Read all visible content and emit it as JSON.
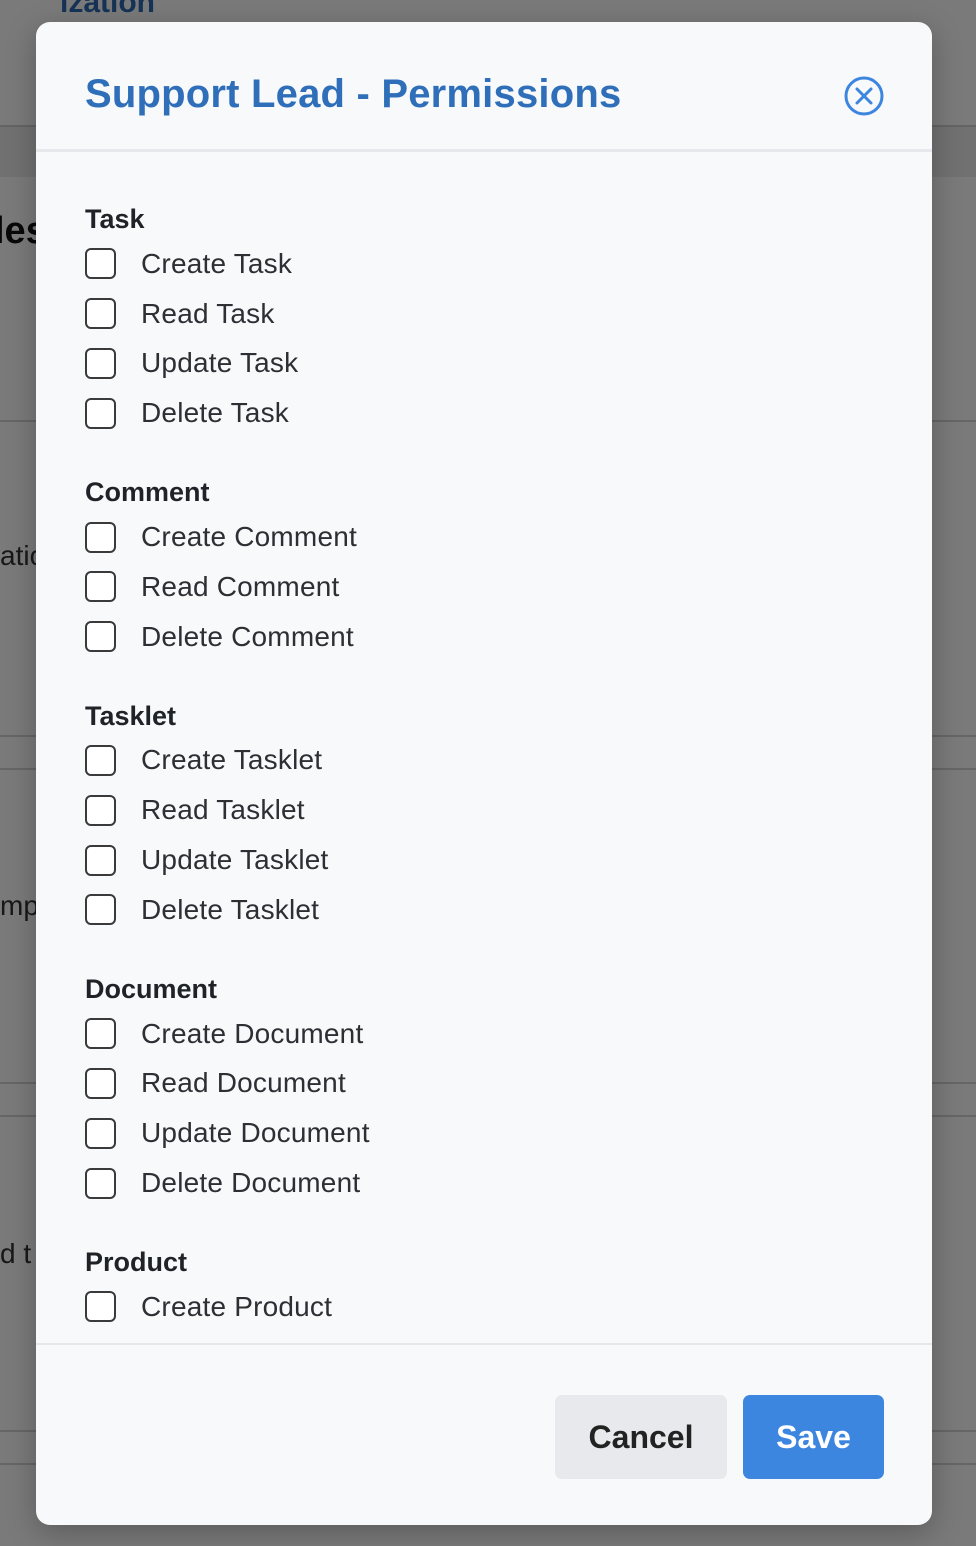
{
  "background": {
    "top_title": "ization",
    "heading": "les",
    "fragments": [
      "atio",
      "mpl",
      "d t"
    ]
  },
  "modal": {
    "title": "Support Lead - Permissions",
    "groups": [
      {
        "title": "Task",
        "permissions": [
          {
            "label": "Create Task",
            "checked": false
          },
          {
            "label": "Read Task",
            "checked": false
          },
          {
            "label": "Update Task",
            "checked": false
          },
          {
            "label": "Delete Task",
            "checked": false
          }
        ]
      },
      {
        "title": "Comment",
        "permissions": [
          {
            "label": "Create Comment",
            "checked": false
          },
          {
            "label": "Read Comment",
            "checked": false
          },
          {
            "label": "Delete Comment",
            "checked": false
          }
        ]
      },
      {
        "title": "Tasklet",
        "permissions": [
          {
            "label": "Create Tasklet",
            "checked": false
          },
          {
            "label": "Read Tasklet",
            "checked": false
          },
          {
            "label": "Update Tasklet",
            "checked": false
          },
          {
            "label": "Delete Tasklet",
            "checked": false
          }
        ]
      },
      {
        "title": "Document",
        "permissions": [
          {
            "label": "Create Document",
            "checked": false
          },
          {
            "label": "Read Document",
            "checked": false
          },
          {
            "label": "Update Document",
            "checked": false
          },
          {
            "label": "Delete Document",
            "checked": false
          }
        ]
      },
      {
        "title": "Product",
        "permissions": [
          {
            "label": "Create Product",
            "checked": false
          }
        ]
      }
    ],
    "footer": {
      "cancel_label": "Cancel",
      "save_label": "Save"
    }
  },
  "colors": {
    "accent": "#3d86e0",
    "title": "#2f6fb9"
  }
}
